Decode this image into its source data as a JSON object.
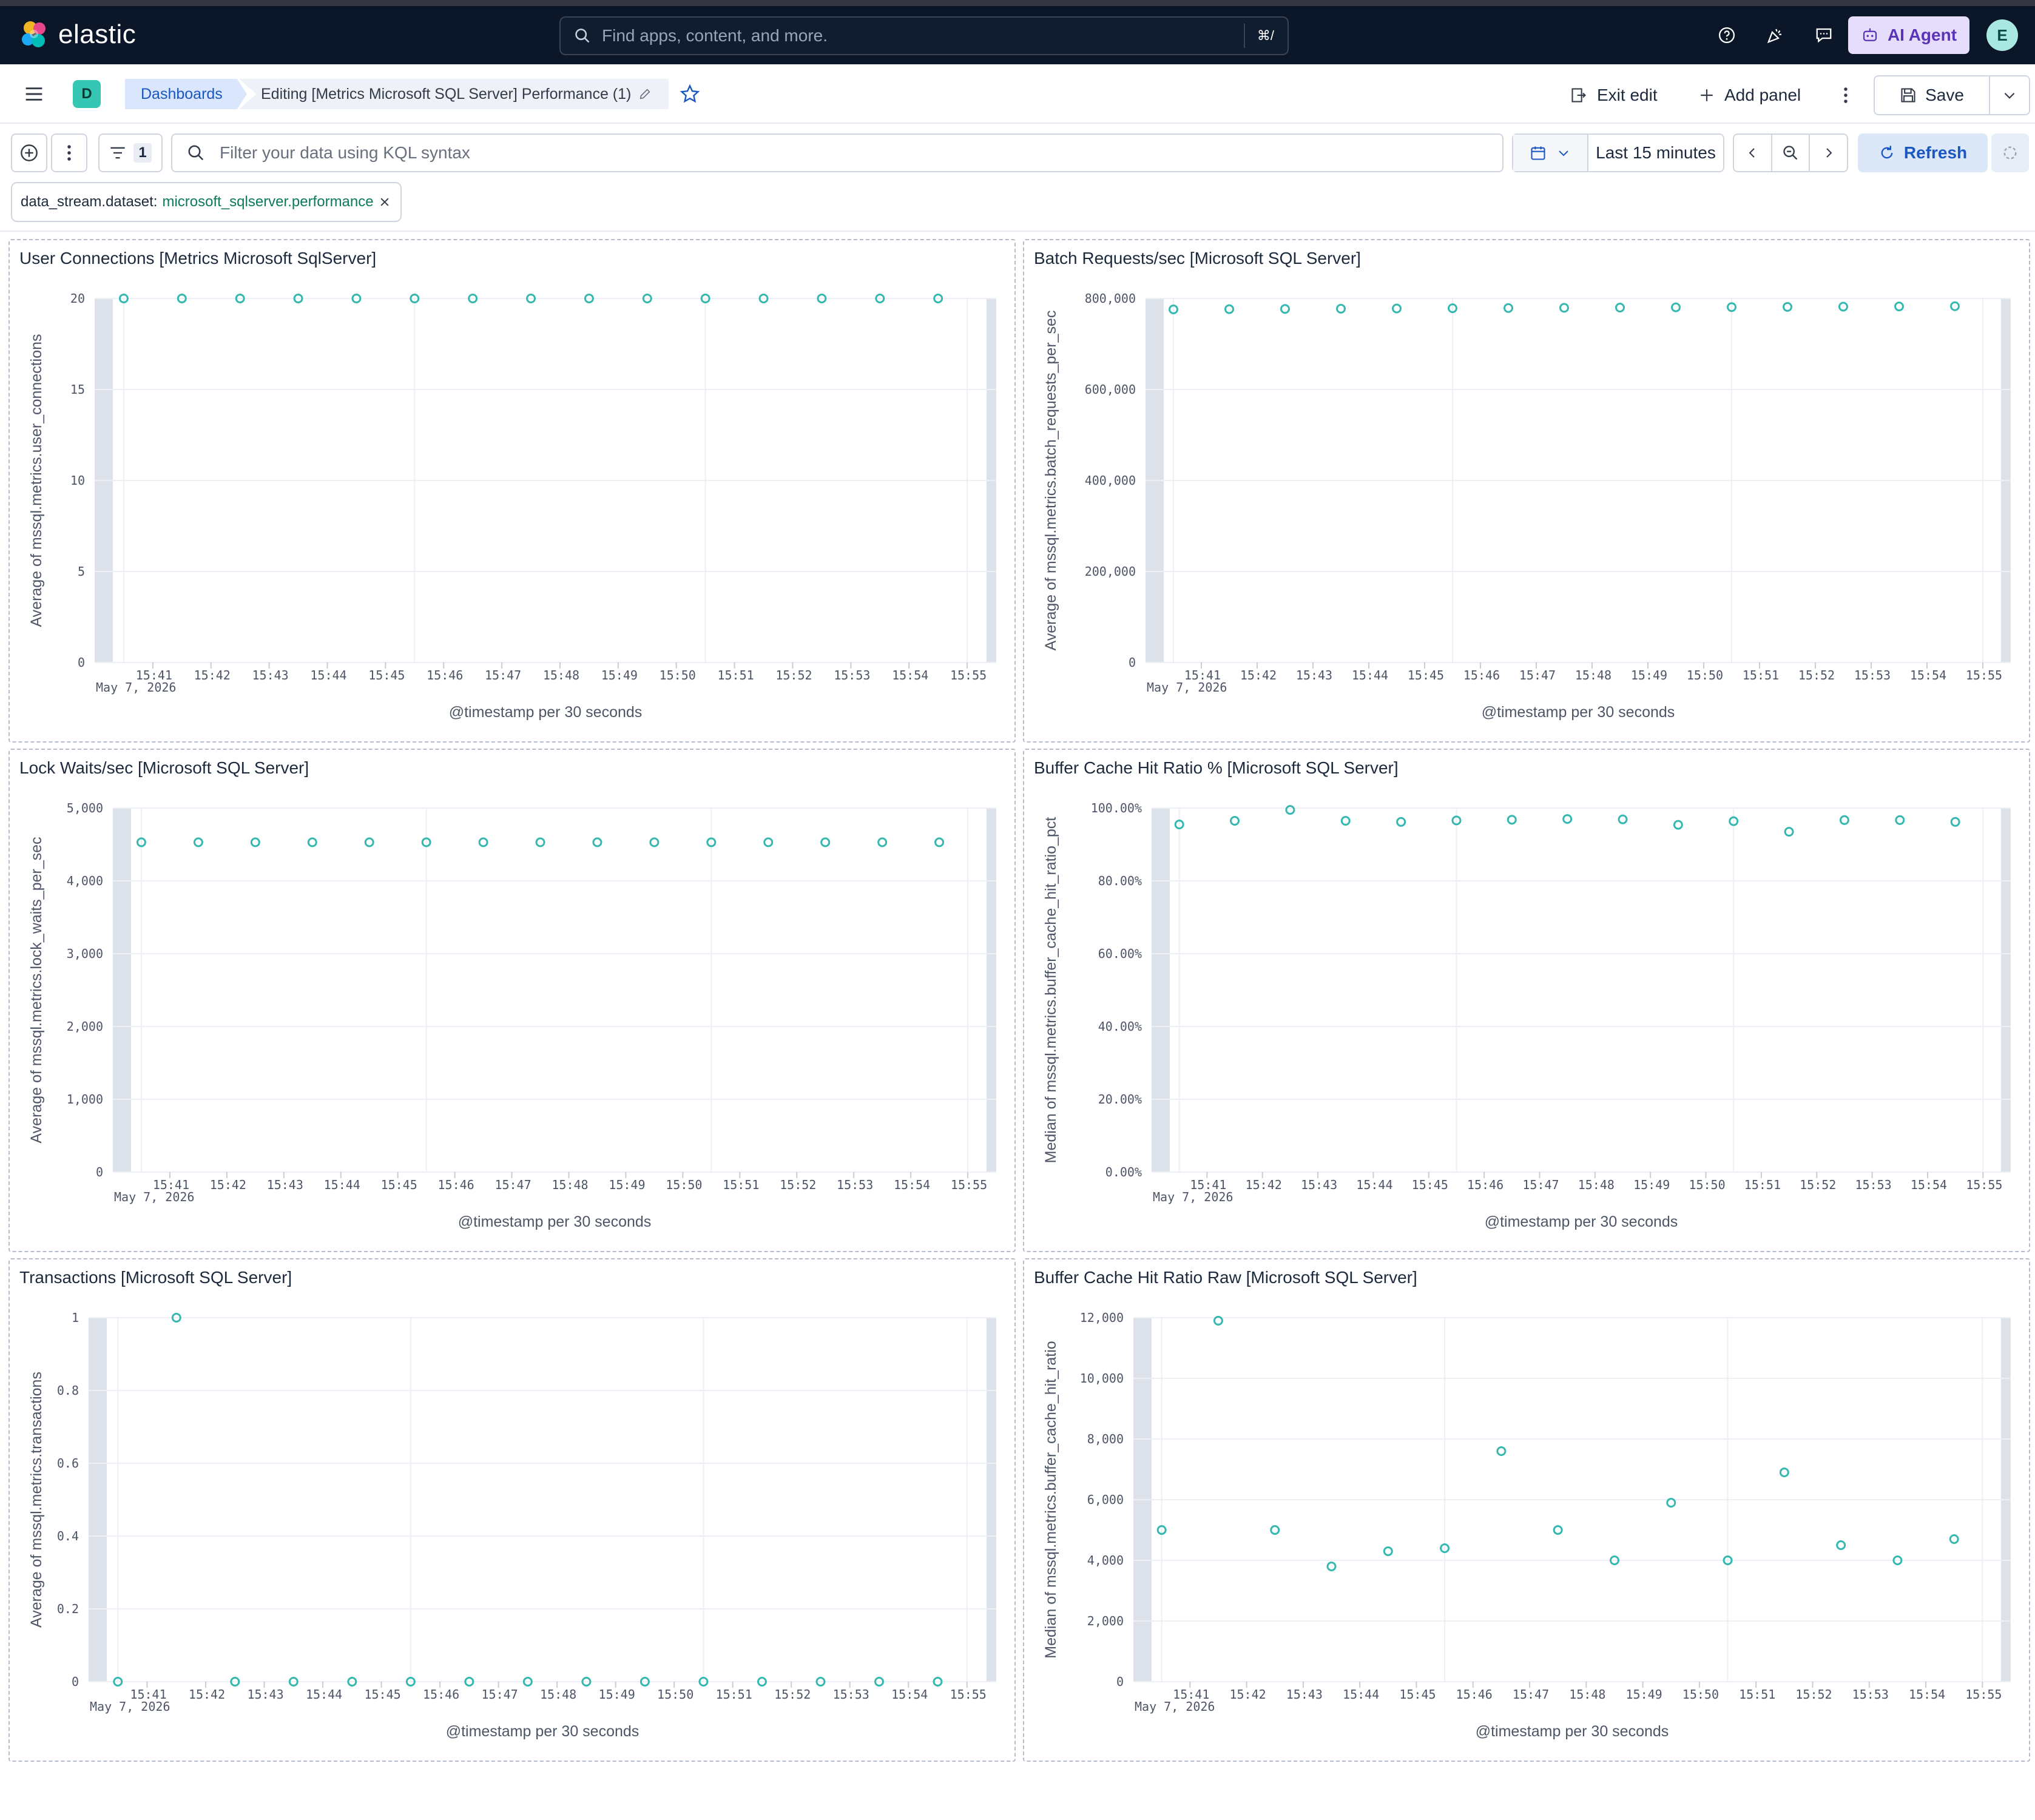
{
  "topbar": {
    "brand": "elastic",
    "search_placeholder": "Find apps, content, and more.",
    "search_shortcut": "⌘/",
    "ai_agent_label": "AI Agent",
    "user_initial": "E",
    "icons": [
      "help-icon",
      "news-feed-icon",
      "feedback-icon"
    ]
  },
  "header": {
    "space_initial": "D",
    "breadcrumb_root": "Dashboards",
    "breadcrumb_current": "Editing [Metrics Microsoft SQL Server] Performance (1)",
    "exit_edit_label": "Exit edit",
    "add_panel_label": "Add panel",
    "save_label": "Save"
  },
  "querybar": {
    "filter_count": "1",
    "kql_placeholder": "Filter your data using KQL syntax",
    "time_range_label": "Last 15 minutes",
    "refresh_label": "Refresh",
    "filter_pill": {
      "field": "data_stream.dataset:",
      "value": "microsoft_sqlserver.performance"
    }
  },
  "colors": {
    "series": "#35b8b0",
    "accent": "#1a57c2",
    "nav_bg": "#0b1628"
  },
  "chart_data": [
    {
      "type": "scatter",
      "title": "User Connections [Metrics Microsoft SqlServer]",
      "xlabel": "@timestamp per 30 seconds",
      "ylabel": "Average of mssql.metrics.user_connections",
      "date_label": "May 7, 2026",
      "x_ticks": [
        "15:41",
        "15:42",
        "15:43",
        "15:44",
        "15:45",
        "15:46",
        "15:47",
        "15:48",
        "15:49",
        "15:50",
        "15:51",
        "15:52",
        "15:53",
        "15:54",
        "15:55"
      ],
      "y_ticks": [
        "0",
        "5",
        "10",
        "15",
        "20"
      ],
      "ylim": [
        0,
        20
      ],
      "x": [
        "15:40:30",
        "15:41:30",
        "15:42:30",
        "15:43:30",
        "15:44:30",
        "15:45:30",
        "15:46:30",
        "15:47:30",
        "15:48:30",
        "15:49:30",
        "15:50:30",
        "15:51:30",
        "15:52:30",
        "15:53:30",
        "15:54:30"
      ],
      "values": [
        20,
        20,
        20,
        20,
        20,
        20,
        20,
        20,
        20,
        20,
        20,
        20,
        20,
        20,
        20
      ],
      "grid": true
    },
    {
      "type": "scatter",
      "title": "Batch Requests/sec [Microsoft SQL Server]",
      "xlabel": "@timestamp per 30 seconds",
      "ylabel": "Average of mssql.metrics.batch_requests_per_sec",
      "date_label": "May 7, 2026",
      "x_ticks": [
        "15:41",
        "15:42",
        "15:43",
        "15:44",
        "15:45",
        "15:46",
        "15:47",
        "15:48",
        "15:49",
        "15:50",
        "15:51",
        "15:52",
        "15:53",
        "15:54",
        "15:55"
      ],
      "y_ticks": [
        "0",
        "200,000",
        "400,000",
        "600,000",
        "800,000"
      ],
      "ylim": [
        0,
        800000
      ],
      "x": [
        "15:40:30",
        "15:41:30",
        "15:42:30",
        "15:43:30",
        "15:44:30",
        "15:45:30",
        "15:46:30",
        "15:47:30",
        "15:48:30",
        "15:49:30",
        "15:50:30",
        "15:51:30",
        "15:52:30",
        "15:53:30",
        "15:54:30"
      ],
      "values": [
        776000,
        776500,
        777000,
        777500,
        778000,
        778500,
        779000,
        779500,
        780000,
        780500,
        781000,
        781500,
        782000,
        782500,
        783000
      ],
      "grid": true
    },
    {
      "type": "scatter",
      "title": "Lock Waits/sec [Microsoft SQL Server]",
      "xlabel": "@timestamp per 30 seconds",
      "ylabel": "Average of mssql.metrics.lock_waits_per_sec",
      "date_label": "May 7, 2026",
      "x_ticks": [
        "15:41",
        "15:42",
        "15:43",
        "15:44",
        "15:45",
        "15:46",
        "15:47",
        "15:48",
        "15:49",
        "15:50",
        "15:51",
        "15:52",
        "15:53",
        "15:54",
        "15:55"
      ],
      "y_ticks": [
        "0",
        "1,000",
        "2,000",
        "3,000",
        "4,000",
        "5,000"
      ],
      "ylim": [
        0,
        5000
      ],
      "x": [
        "15:40:30",
        "15:41:30",
        "15:42:30",
        "15:43:30",
        "15:44:30",
        "15:45:30",
        "15:46:30",
        "15:47:30",
        "15:48:30",
        "15:49:30",
        "15:50:30",
        "15:51:30",
        "15:52:30",
        "15:53:30",
        "15:54:30"
      ],
      "values": [
        4530,
        4530,
        4530,
        4530,
        4530,
        4530,
        4530,
        4530,
        4530,
        4530,
        4530,
        4530,
        4530,
        4530,
        4530
      ],
      "grid": true
    },
    {
      "type": "scatter",
      "title": "Buffer Cache Hit Ratio % [Microsoft SQL Server]",
      "xlabel": "@timestamp per 30 seconds",
      "ylabel": "Median of mssql.metrics.buffer_cache_hit_ratio_pct",
      "date_label": "May 7, 2026",
      "x_ticks": [
        "15:41",
        "15:42",
        "15:43",
        "15:44",
        "15:45",
        "15:46",
        "15:47",
        "15:48",
        "15:49",
        "15:50",
        "15:51",
        "15:52",
        "15:53",
        "15:54",
        "15:55"
      ],
      "y_ticks": [
        "0.00%",
        "20.00%",
        "40.00%",
        "60.00%",
        "80.00%",
        "100.00%"
      ],
      "ylim": [
        0,
        100
      ],
      "x": [
        "15:40:30",
        "15:41:30",
        "15:42:30",
        "15:43:30",
        "15:44:30",
        "15:45:30",
        "15:46:30",
        "15:47:30",
        "15:48:30",
        "15:49:30",
        "15:50:30",
        "15:51:30",
        "15:52:30",
        "15:53:30",
        "15:54:30"
      ],
      "values": [
        95.5,
        96.5,
        99.5,
        96.5,
        96.2,
        96.6,
        96.8,
        97.0,
        96.9,
        95.4,
        96.4,
        93.5,
        96.7,
        96.7,
        96.2
      ],
      "grid": true
    },
    {
      "type": "scatter",
      "title": "Transactions [Microsoft SQL Server]",
      "xlabel": "@timestamp per 30 seconds",
      "ylabel": "Average of mssql.metrics.transactions",
      "date_label": "May 7, 2026",
      "x_ticks": [
        "15:41",
        "15:42",
        "15:43",
        "15:44",
        "15:45",
        "15:46",
        "15:47",
        "15:48",
        "15:49",
        "15:50",
        "15:51",
        "15:52",
        "15:53",
        "15:54",
        "15:55"
      ],
      "y_ticks": [
        "0",
        "0.2",
        "0.4",
        "0.6",
        "0.8",
        "1"
      ],
      "ylim": [
        0,
        1
      ],
      "x": [
        "15:40:30",
        "15:41:30",
        "15:42:30",
        "15:43:30",
        "15:44:30",
        "15:45:30",
        "15:46:30",
        "15:47:30",
        "15:48:30",
        "15:49:30",
        "15:50:30",
        "15:51:30",
        "15:52:30",
        "15:53:30",
        "15:54:30"
      ],
      "values": [
        0,
        1,
        0,
        0,
        0,
        0,
        0,
        0,
        0,
        0,
        0,
        0,
        0,
        0,
        0
      ],
      "grid": true
    },
    {
      "type": "scatter",
      "title": "Buffer Cache Hit Ratio Raw [Microsoft SQL Server]",
      "xlabel": "@timestamp per 30 seconds",
      "ylabel": "Median of mssql.metrics.buffer_cache_hit_ratio",
      "date_label": "May 7, 2026",
      "x_ticks": [
        "15:41",
        "15:42",
        "15:43",
        "15:44",
        "15:45",
        "15:46",
        "15:47",
        "15:48",
        "15:49",
        "15:50",
        "15:51",
        "15:52",
        "15:53",
        "15:54",
        "15:55"
      ],
      "y_ticks": [
        "0",
        "2,000",
        "4,000",
        "6,000",
        "8,000",
        "10,000",
        "12,000"
      ],
      "ylim": [
        0,
        12000
      ],
      "x": [
        "15:40:30",
        "15:41:30",
        "15:42:30",
        "15:43:30",
        "15:44:30",
        "15:45:30",
        "15:46:30",
        "15:47:30",
        "15:48:30",
        "15:49:30",
        "15:50:30",
        "15:51:30",
        "15:52:30",
        "15:53:30",
        "15:54:30"
      ],
      "values": [
        5000,
        11900,
        5000,
        3800,
        4300,
        4400,
        7600,
        5000,
        4000,
        5900,
        4000,
        6900,
        4500,
        4000,
        4700
      ],
      "grid": true
    }
  ]
}
